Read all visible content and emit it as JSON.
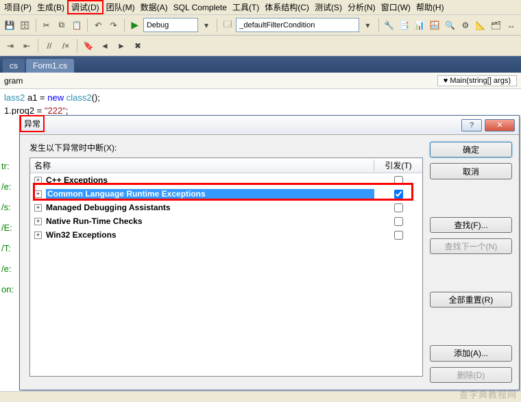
{
  "menu": {
    "items": [
      "项目(P)",
      "生成(B)",
      "调试(D)",
      "团队(M)",
      "数据(A)",
      "SQL Complete",
      "工具(T)",
      "体系结构(C)",
      "测试(S)",
      "分析(N)",
      "窗口(W)",
      "帮助(H)"
    ],
    "highlighted_index": 2
  },
  "toolbar1": {
    "config_combo": "Debug",
    "filter_combo": "_defaultFilterCondition"
  },
  "tabs": {
    "items": [
      "cs",
      "Form1.cs"
    ]
  },
  "breadcrumb": {
    "left": "gram",
    "right": "♥ Main(string[] args)"
  },
  "code": {
    "line1_pre": "lass2",
    "line1_var": " a1 = ",
    "line1_new": "new",
    "line1_post": " ",
    "line1_type2": "class2",
    "line1_end": "();",
    "line2_pre": "1.proq2 = ",
    "line2_str": "\"222\"",
    "line2_end": ";"
  },
  "gutter": [
    "tr:",
    "",
    "/e:",
    "",
    "/s:",
    "/E:",
    "/T:",
    "",
    "/e:",
    "",
    "",
    "on:"
  ],
  "dialog": {
    "title": "异常",
    "label": "发生以下异常时中断(X):",
    "columns": {
      "name": "名称",
      "thrown": "引发(T)"
    },
    "rows": [
      {
        "text": "C++ Exceptions",
        "checked": false,
        "selected": false
      },
      {
        "text": "Common Language Runtime Exceptions",
        "checked": true,
        "selected": true
      },
      {
        "text": "Managed Debugging Assistants",
        "checked": false,
        "selected": false
      },
      {
        "text": "Native Run-Time Checks",
        "checked": false,
        "selected": false
      },
      {
        "text": "Win32 Exceptions",
        "checked": false,
        "selected": false
      }
    ],
    "buttons": {
      "ok": "确定",
      "cancel": "取消",
      "find": "查找(F)...",
      "find_next": "查找下一个(N)",
      "reset_all": "全部重置(R)",
      "add": "添加(A)...",
      "delete": "删除(D)"
    },
    "help_glyph": "?",
    "close_glyph": "✕"
  },
  "watermark": "查字典教程网"
}
